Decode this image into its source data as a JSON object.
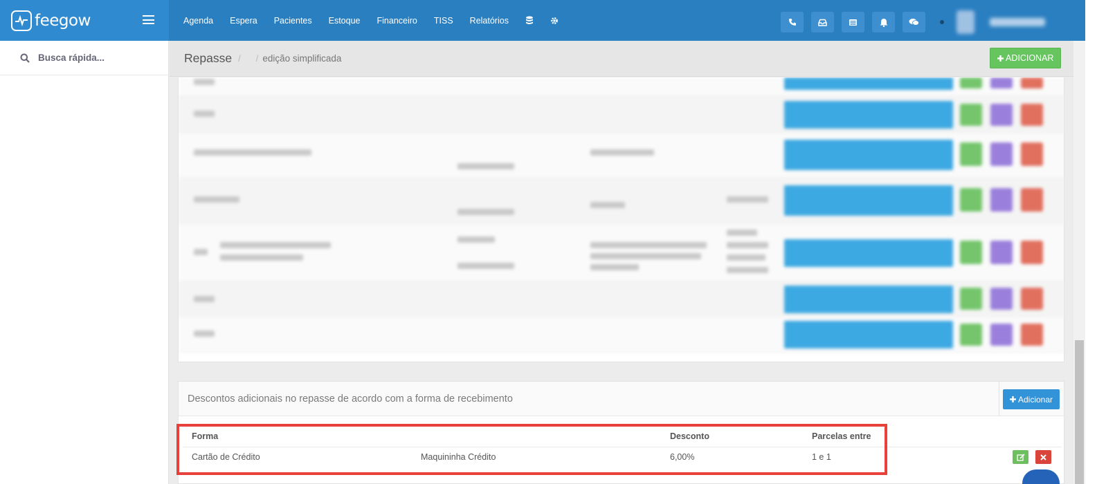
{
  "app": {
    "brand": "feegow"
  },
  "nav": {
    "items": [
      "Agenda",
      "Espera",
      "Pacientes",
      "Estoque",
      "Financeiro",
      "TISS",
      "Relatórios"
    ],
    "icons": [
      "database-icon",
      "gear-icon"
    ]
  },
  "topbar": {
    "actions": [
      "phone-icon",
      "inbox-icon",
      "list-icon",
      "bell-icon",
      "chat-icon"
    ]
  },
  "sidebar": {
    "search_label": "Busca rápida..."
  },
  "page": {
    "title": "Repasse",
    "separator": "/",
    "breadcrumb": "edição simplificada",
    "add_button": "ADICIONAR"
  },
  "descontos": {
    "title": "Descontos adicionais no repasse de acordo com a forma de recebimento",
    "add_button": "Adicionar",
    "headers": {
      "forma": "Forma",
      "desconto": "Desconto",
      "parcelas": "Parcelas entre"
    },
    "rows": [
      {
        "forma": "Cartão de Crédito",
        "conta": "Maquininha Crédito",
        "desconto": "6,00%",
        "parcelas": "1 e 1"
      }
    ]
  },
  "colors": {
    "topbar": "#2a7fc1",
    "brand_bg": "#2f8ad0",
    "add_green": "#67c560",
    "add_blue": "#3293d8",
    "highlight_red": "#e8403a",
    "edit_green": "#6dbf5f",
    "delete_red": "#d9453a"
  }
}
